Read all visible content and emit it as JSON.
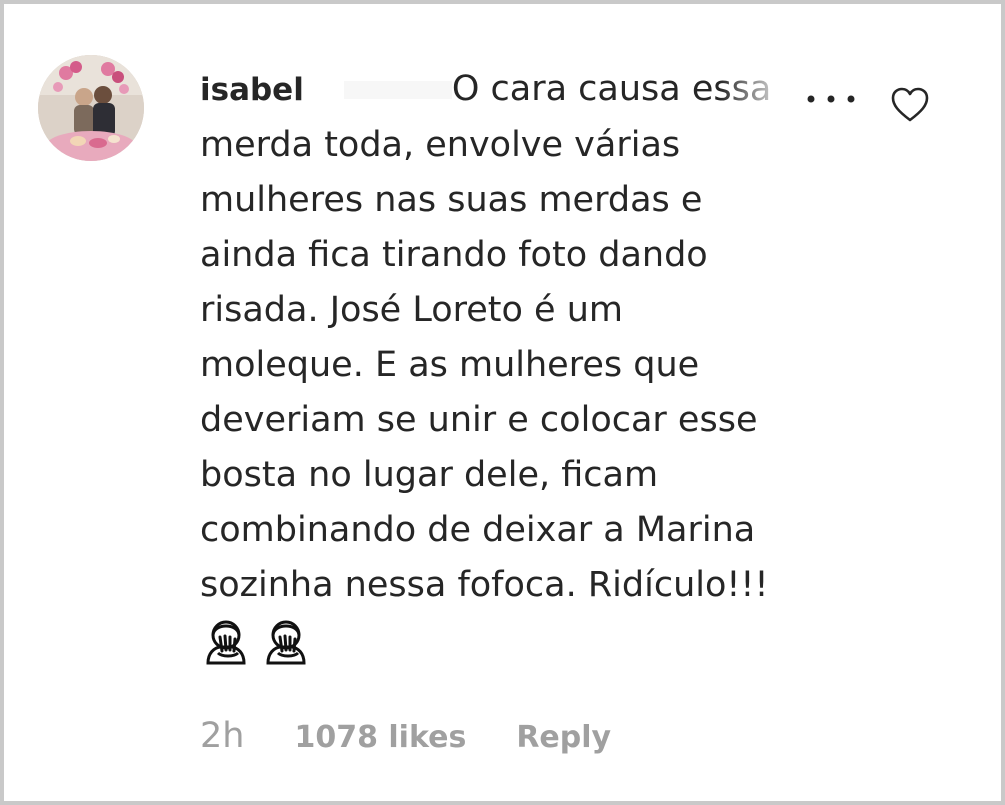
{
  "comment": {
    "username": "isabel",
    "lines": [
      "O cara causa essa",
      "merda toda, envolve várias",
      "mulheres nas suas merdas e",
      "ainda fica tirando foto dando",
      "risada. José Loreto é um",
      "moleque. E as mulheres que",
      "deveriam se unir e colocar esse",
      "bosta no lugar dele, ficam",
      "combinando de deixar a Marina",
      "sozinha nessa fofoca. Ridículo!!!"
    ],
    "emojis": [
      "face-palm-emoji",
      "face-palm-emoji"
    ]
  },
  "meta": {
    "time": "2h",
    "likes": "1078 likes",
    "reply": "Reply"
  },
  "icons": {
    "more": "more-options-icon",
    "like": "heart-icon"
  },
  "colors": {
    "text": "#262626",
    "secondary": "#a0a0a0",
    "border": "#c9c9c9"
  }
}
